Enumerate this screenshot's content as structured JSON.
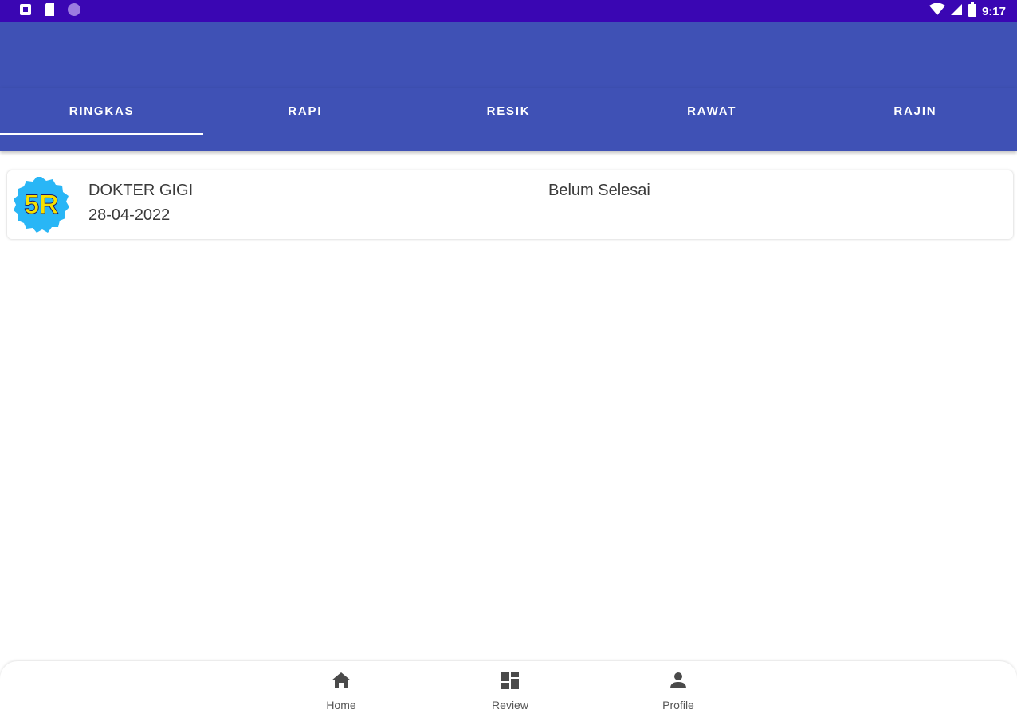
{
  "status_bar": {
    "time": "9:17",
    "icons": [
      "notification-icon",
      "sd-card-icon",
      "circle-app-icon",
      "wifi-icon",
      "signal-icon",
      "battery-icon"
    ]
  },
  "tabs": [
    {
      "label": "RINGKAS",
      "active": true
    },
    {
      "label": "RAPI",
      "active": false
    },
    {
      "label": "RESIK",
      "active": false
    },
    {
      "label": "RAWAT",
      "active": false
    },
    {
      "label": "RAJIN",
      "active": false
    }
  ],
  "list": [
    {
      "logo_text": "5R",
      "name": "DOKTER GIGI",
      "date": "28-04-2022",
      "status": "Belum Selesai"
    }
  ],
  "bottom_nav": [
    {
      "label": "Home",
      "icon": "home-icon"
    },
    {
      "label": "Review",
      "icon": "dashboard-icon"
    },
    {
      "label": "Profile",
      "icon": "person-icon"
    }
  ],
  "colors": {
    "status_bar": "#3a06b3",
    "primary": "#3f51b5",
    "logo_badge": "#29b6f6",
    "logo_text": "#f5e000"
  }
}
